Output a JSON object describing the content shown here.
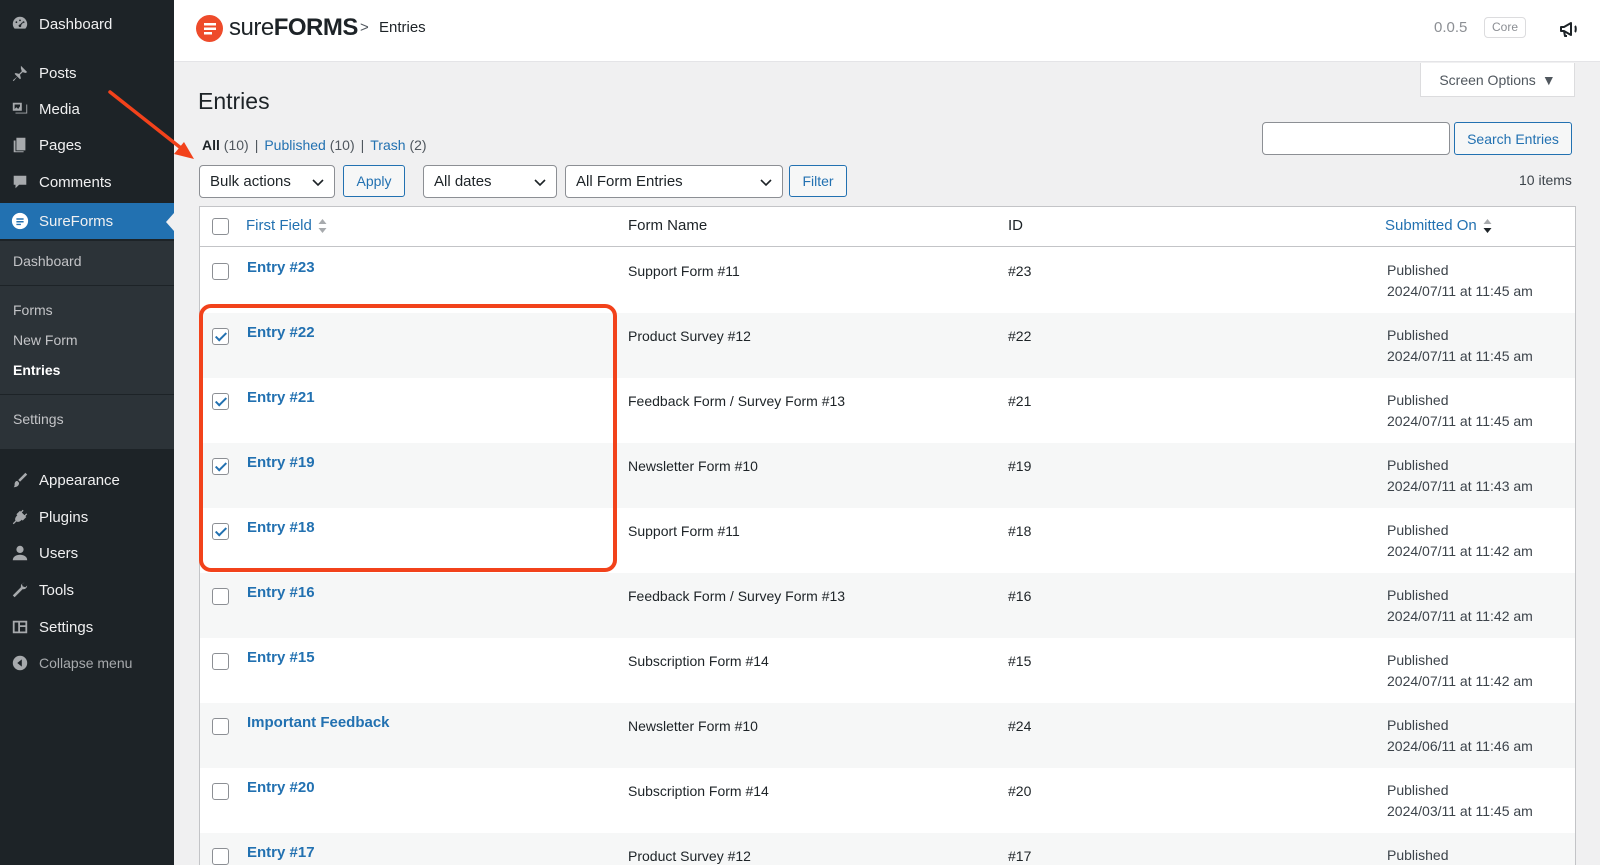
{
  "sidebar": {
    "items": [
      {
        "label": "Dashboard",
        "icon": "dashboard-icon"
      },
      {
        "label": "Posts",
        "icon": "pin-icon"
      },
      {
        "label": "Media",
        "icon": "media-icon"
      },
      {
        "label": "Pages",
        "icon": "pages-icon"
      },
      {
        "label": "Comments",
        "icon": "comments-icon"
      },
      {
        "label": "SureForms",
        "icon": "sureforms-icon"
      },
      {
        "label": "Appearance",
        "icon": "brush-icon"
      },
      {
        "label": "Plugins",
        "icon": "plug-icon"
      },
      {
        "label": "Users",
        "icon": "user-icon"
      },
      {
        "label": "Tools",
        "icon": "wrench-icon"
      },
      {
        "label": "Settings",
        "icon": "settings-icon"
      }
    ],
    "submenu": [
      "Dashboard",
      "Forms",
      "New Form",
      "Entries",
      "Settings"
    ],
    "collapse_label": "Collapse menu"
  },
  "header": {
    "logo_light": "sure",
    "logo_bold": "FORMS",
    "breadcrumb_sep": ">",
    "breadcrumb": "Entries",
    "version": "0.0.5",
    "badge": "Core",
    "accent_color": "#ee4b2b"
  },
  "screen_options": "Screen Options",
  "page_title": "Entries",
  "views": {
    "all": "All",
    "all_count": "(10)",
    "published": "Published",
    "published_count": "(10)",
    "trash": "Trash",
    "trash_count": "(2)",
    "sep": "|"
  },
  "search_button": "Search Entries",
  "toolbar": {
    "bulk_actions": "Bulk actions",
    "apply": "Apply",
    "dates": "All dates",
    "form_entries": "All Form Entries",
    "filter": "Filter",
    "items_count": "10 items"
  },
  "table": {
    "columns": {
      "first_field": "First Field",
      "form_name": "Form Name",
      "id": "ID",
      "submitted_on": "Submitted On"
    },
    "rows": [
      {
        "title": "Entry #23",
        "form": "Support Form #11",
        "id": "#23",
        "status": "Published",
        "date": "2024/07/11 at 11:45 am",
        "checked": false
      },
      {
        "title": "Entry #22",
        "form": "Product Survey #12",
        "id": "#22",
        "status": "Published",
        "date": "2024/07/11 at 11:45 am",
        "checked": true
      },
      {
        "title": "Entry #21",
        "form": "Feedback Form / Survey Form #13",
        "id": "#21",
        "status": "Published",
        "date": "2024/07/11 at 11:45 am",
        "checked": true
      },
      {
        "title": "Entry #19",
        "form": "Newsletter Form #10",
        "id": "#19",
        "status": "Published",
        "date": "2024/07/11 at 11:43 am",
        "checked": true
      },
      {
        "title": "Entry #18",
        "form": "Support Form #11",
        "id": "#18",
        "status": "Published",
        "date": "2024/07/11 at 11:42 am",
        "checked": true
      },
      {
        "title": "Entry #16",
        "form": "Feedback Form / Survey Form #13",
        "id": "#16",
        "status": "Published",
        "date": "2024/07/11 at 11:42 am",
        "checked": false
      },
      {
        "title": "Entry #15",
        "form": "Subscription Form #14",
        "id": "#15",
        "status": "Published",
        "date": "2024/07/11 at 11:42 am",
        "checked": false
      },
      {
        "title": "Important Feedback",
        "form": "Newsletter Form #10",
        "id": "#24",
        "status": "Published",
        "date": "2024/06/11 at 11:46 am",
        "checked": false
      },
      {
        "title": "Entry #20",
        "form": "Subscription Form #14",
        "id": "#20",
        "status": "Published",
        "date": "2024/03/11 at 11:45 am",
        "checked": false
      },
      {
        "title": "Entry #17",
        "form": "Product Survey #12",
        "id": "#17",
        "status": "Published",
        "date": "",
        "checked": false
      }
    ]
  }
}
